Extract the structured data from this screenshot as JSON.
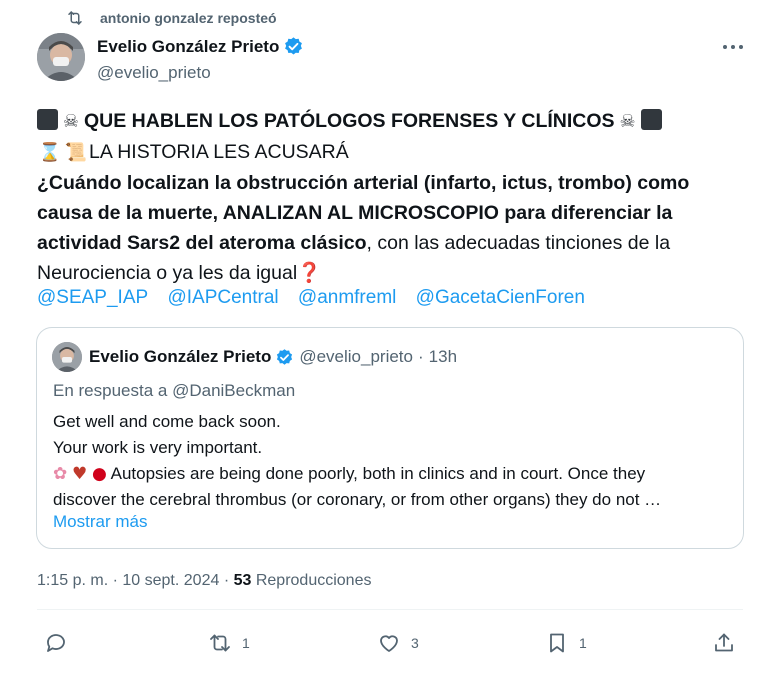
{
  "repost": {
    "text": "antonio gonzalez reposteó"
  },
  "author": {
    "name": "Evelio González Prieto",
    "handle": "@evelio_prieto"
  },
  "tweet": {
    "line1": "QUE HABLEN LOS PATÓLOGOS FORENSES Y CLÍNICOS",
    "line2": "LA HISTORIA LES ACUSARÁ",
    "bold_text": "¿Cuándo localizan la obstrucción arterial (infarto, ictus, trombo) como causa de la muerte, ANALIZAN AL MICROSCOPIO para diferenciar la actividad Sars2 del ateroma clásico",
    "normal_text": ", con las adecuadas tinciones de la Neurociencia o ya les da igual",
    "mentions": [
      "@SEAP_IAP",
      "@IAPCentral",
      "@anmfreml",
      "@GacetaCienForen"
    ]
  },
  "quote": {
    "name": "Evelio González Prieto",
    "handle": "@evelio_prieto",
    "separator": "·",
    "time": "13h",
    "reply_to": "En respuesta a @DaniBeckman",
    "line1": "Get well and come back soon.",
    "line2": "Your work is very important.",
    "line3": "Autopsies are being done poorly, both in clinics and in court. Once they",
    "line4": "discover the cerebral thrombus (or coronary, or from other organs) they do not …",
    "show_more": "Mostrar más"
  },
  "meta": {
    "time": "1:15 p. m.",
    "separator": "·",
    "date": "10 sept. 2024",
    "views_count": "53",
    "views_label": "Reproducciones"
  },
  "actions": {
    "reply_count": "",
    "repost_count": "1",
    "like_count": "3",
    "bookmark_count": "1"
  },
  "colors": {
    "accent": "#1d9bf0",
    "secondary_text": "#536471",
    "border": "#cfd9de"
  },
  "icons": [
    "repost-icon",
    "verified-badge-icon",
    "more-icon",
    "skull-icon",
    "hourglass-icon",
    "scroll-icon",
    "question-mark-icon",
    "brain-icon",
    "heart-organ-icon",
    "blood-drop-icon",
    "reply-icon",
    "like-icon",
    "bookmark-icon",
    "share-icon"
  ]
}
